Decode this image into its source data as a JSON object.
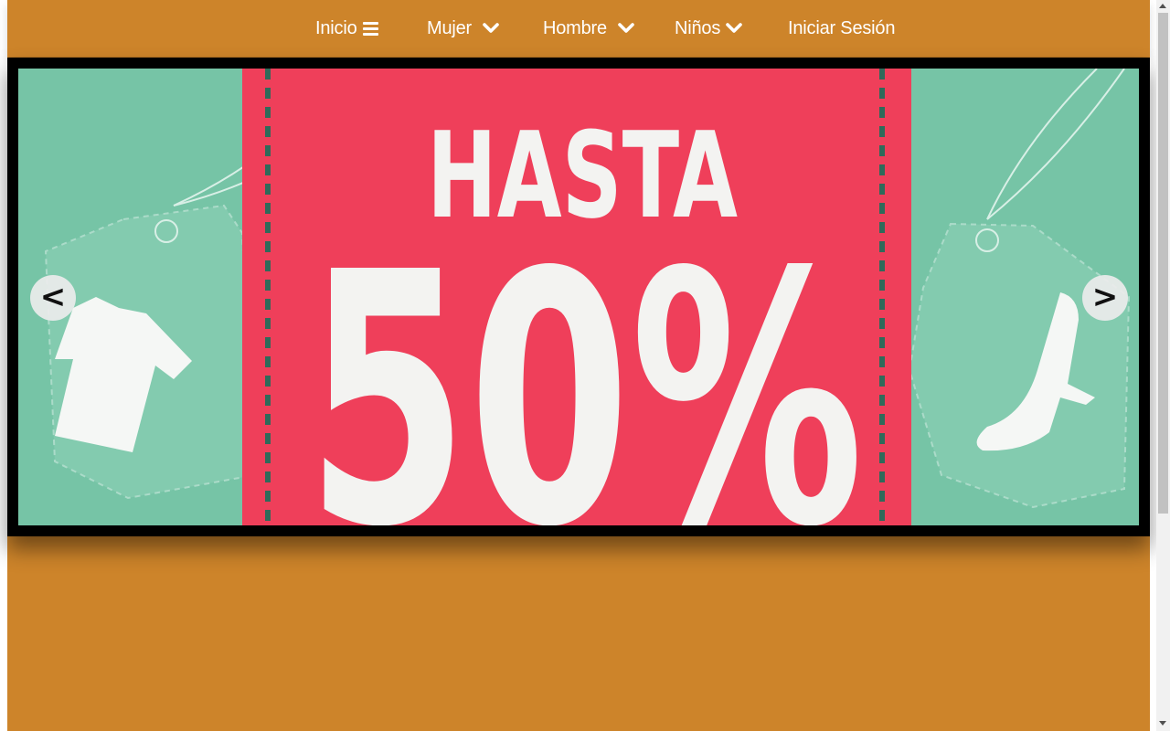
{
  "nav": {
    "items": [
      {
        "label": "Inicio",
        "icon": "bars-icon"
      },
      {
        "label": "Mujer",
        "icon": "chevron-down-icon"
      },
      {
        "label": "Hombre",
        "icon": "chevron-down-icon"
      },
      {
        "label": "Niños",
        "icon": "chevron-down-icon"
      },
      {
        "label": "Iniciar Sesión",
        "icon": ""
      }
    ]
  },
  "slider": {
    "banner": {
      "headline": "HASTA",
      "discount": "50%",
      "left_item": "shirt-icon",
      "right_item": "high-heel-icon"
    },
    "prev_label": "<",
    "next_label": ">"
  },
  "colors": {
    "page_background": "#cd842a",
    "nav_text": "#ffffff",
    "slider_frame": "#000000",
    "banner_teal": "#76c4a6",
    "banner_pink": "#ef3f5a",
    "banner_text": "#f3f3f1"
  }
}
